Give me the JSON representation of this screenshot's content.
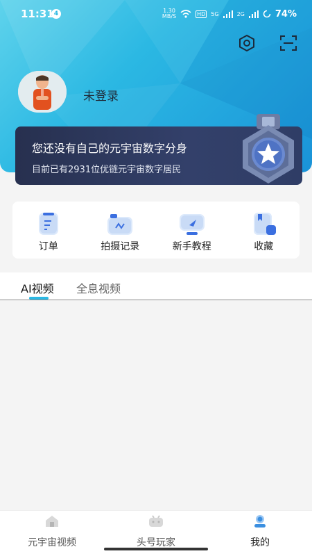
{
  "status_bar": {
    "time": "11:31",
    "notification_count": "4",
    "net_speed_value": "1.30",
    "net_speed_unit": "MB/S",
    "hd_label": "HD",
    "sim1_label": "5G",
    "sim2_label": "2G",
    "battery": "74%"
  },
  "header": {
    "settings_icon": "hexagon-settings-icon",
    "scan_icon": "scan-icon"
  },
  "profile": {
    "login_status": "未登录"
  },
  "promo": {
    "title": "您还没有自己的元宇宙数字分身",
    "subtitle": "目前已有2931位优链元宇宙数字居民"
  },
  "shortcuts": [
    {
      "label": "订单",
      "icon": "order-icon"
    },
    {
      "label": "拍摄记录",
      "icon": "video-record-icon"
    },
    {
      "label": "新手教程",
      "icon": "tutorial-icon"
    },
    {
      "label": "收藏",
      "icon": "favorite-icon"
    }
  ],
  "tabs": [
    {
      "label": "AI视频",
      "active": true
    },
    {
      "label": "全息视频",
      "active": false
    }
  ],
  "bottom_nav": [
    {
      "label": "元宇宙视频",
      "icon": "home-icon",
      "active": false
    },
    {
      "label": "头号玩家",
      "icon": "gamepad-icon",
      "active": false
    },
    {
      "label": "我的",
      "icon": "profile-icon",
      "active": true
    }
  ],
  "colors": {
    "accent": "#2bb8e3",
    "promo_bg": "#2f3a5f"
  }
}
